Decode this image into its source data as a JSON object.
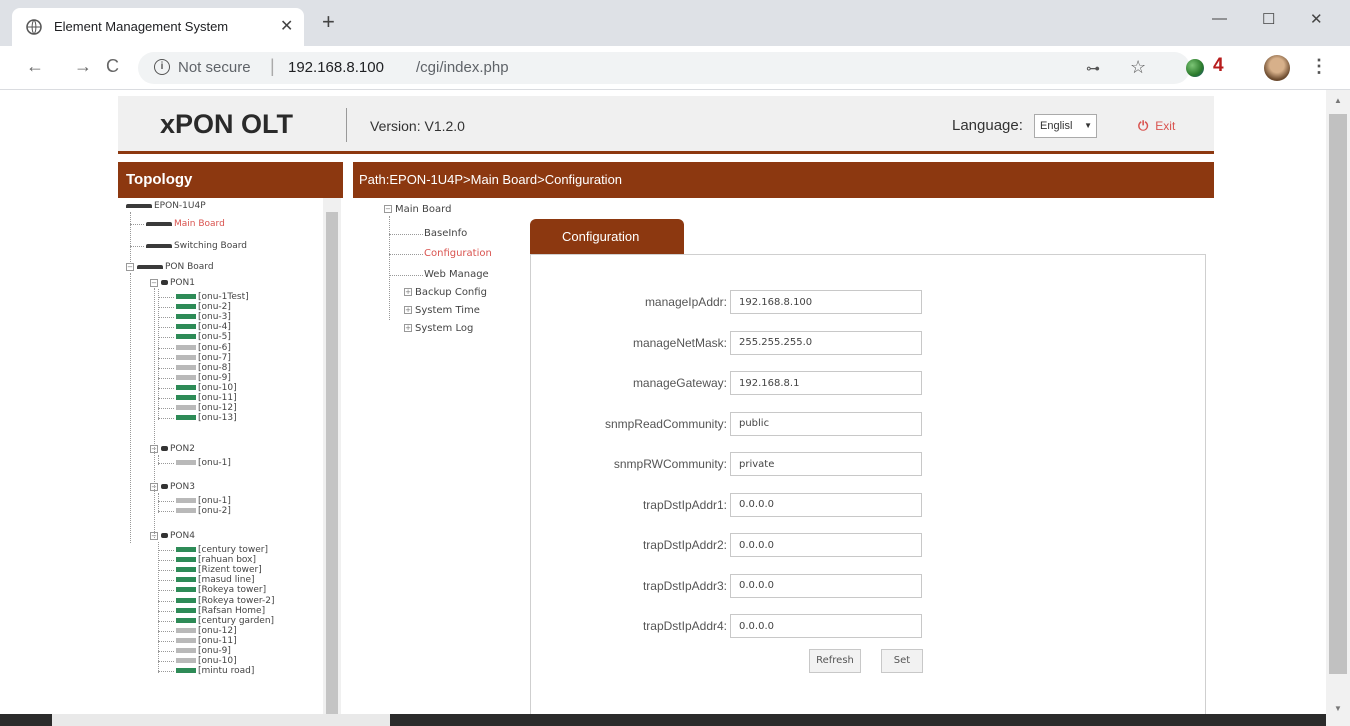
{
  "browser": {
    "tab_title": "Element Management System",
    "tab_close": "✕",
    "new_tab": "+",
    "minimize": "—",
    "restore": "☐",
    "close": "✕",
    "back": "←",
    "forward": "→",
    "reload": "C",
    "omnibox_info": "i",
    "not_secure": "Not secure",
    "url_separator": "|",
    "url_host": "192.168.8.100",
    "url_path": "/cgi/index.php",
    "key_icon": "⊶",
    "star_icon": "☆",
    "extension_badge": "4",
    "menu_icon": "⋮"
  },
  "header": {
    "logo": "xPON OLT",
    "version": "Version: V1.2.0",
    "language_label": "Language:",
    "language_value": "Englisl",
    "exit_label": "Exit",
    "exit_icon": "⏻"
  },
  "topology": {
    "title": "Topology",
    "root": "EPON-1U4P",
    "main_board": "Main Board",
    "switching_board": "Switching Board",
    "pon_board": "PON Board",
    "pons": [
      {
        "name": "PON1",
        "onus": [
          {
            "label": "[onu-1Test]",
            "online": true
          },
          {
            "label": "[onu-2]",
            "online": true
          },
          {
            "label": "[onu-3]",
            "online": true
          },
          {
            "label": "[onu-4]",
            "online": true
          },
          {
            "label": "[onu-5]",
            "online": true
          },
          {
            "label": "[onu-6]",
            "online": false
          },
          {
            "label": "[onu-7]",
            "online": false
          },
          {
            "label": "[onu-8]",
            "online": false
          },
          {
            "label": "[onu-9]",
            "online": false
          },
          {
            "label": "[onu-10]",
            "online": true
          },
          {
            "label": "[onu-11]",
            "online": true
          },
          {
            "label": "[onu-12]",
            "online": false
          },
          {
            "label": "[onu-13]",
            "online": true
          }
        ]
      },
      {
        "name": "PON2",
        "onus": [
          {
            "label": "[onu-1]",
            "online": false
          }
        ]
      },
      {
        "name": "PON3",
        "onus": [
          {
            "label": "[onu-1]",
            "online": false
          },
          {
            "label": "[onu-2]",
            "online": false
          }
        ]
      },
      {
        "name": "PON4",
        "onus": [
          {
            "label": "[century tower]",
            "online": true
          },
          {
            "label": "[rahuan box]",
            "online": true
          },
          {
            "label": "[Rizent tower]",
            "online": true
          },
          {
            "label": "[masud line]",
            "online": true
          },
          {
            "label": "[Rokeya tower]",
            "online": true
          },
          {
            "label": "[Rokeya tower-2]",
            "online": true
          },
          {
            "label": "[Rafsan Home]",
            "online": true
          },
          {
            "label": "[century garden]",
            "online": true
          },
          {
            "label": "[onu-12]",
            "online": false
          },
          {
            "label": "[onu-11]",
            "online": false
          },
          {
            "label": "[onu-9]",
            "online": false
          },
          {
            "label": "[onu-10]",
            "online": false
          },
          {
            "label": "[mintu road]",
            "online": true
          }
        ]
      }
    ]
  },
  "path": "Path:EPON-1U4P>Main Board>Configuration",
  "menu": {
    "root": "Main Board",
    "items": [
      {
        "label": "BaseInfo",
        "expandable": false,
        "active": false
      },
      {
        "label": "Configuration",
        "expandable": false,
        "active": true
      },
      {
        "label": "Web Manage",
        "expandable": false,
        "active": false
      },
      {
        "label": "Backup Config",
        "expandable": true,
        "active": false
      },
      {
        "label": "System Time",
        "expandable": true,
        "active": false
      },
      {
        "label": "System Log",
        "expandable": true,
        "active": false
      }
    ]
  },
  "config": {
    "tab_label": "Configuration",
    "fields": [
      {
        "label": "manageIpAddr:",
        "value": "192.168.8.100"
      },
      {
        "label": "manageNetMask:",
        "value": "255.255.255.0"
      },
      {
        "label": "manageGateway:",
        "value": "192.168.8.1"
      },
      {
        "label": "snmpReadCommunity:",
        "value": "public"
      },
      {
        "label": "snmpRWCommunity:",
        "value": "private"
      },
      {
        "label": "trapDstIpAddr1:",
        "value": "0.0.0.0"
      },
      {
        "label": "trapDstIpAddr2:",
        "value": "0.0.0.0"
      },
      {
        "label": "trapDstIpAddr3:",
        "value": "0.0.0.0"
      },
      {
        "label": "trapDstIpAddr4:",
        "value": "0.0.0.0"
      }
    ],
    "refresh_label": "Refresh",
    "set_label": "Set"
  },
  "colors": {
    "accent": "#8c3810",
    "online": "#2e8b57",
    "offline": "#b9b9b9",
    "active_link": "#d9534f"
  }
}
